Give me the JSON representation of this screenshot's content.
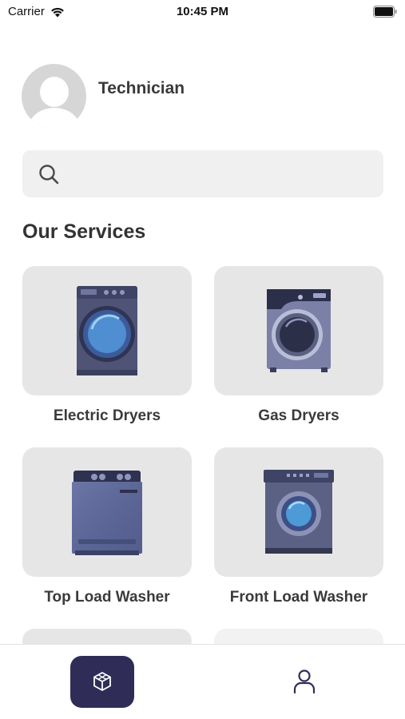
{
  "status_bar": {
    "carrier": "Carrier",
    "time": "10:45 PM"
  },
  "profile": {
    "name": "Technician",
    "avatar_icon": "person-placeholder-icon"
  },
  "search": {
    "placeholder": "",
    "icon": "search-icon"
  },
  "services": {
    "title": "Our Services",
    "items": [
      {
        "label": "Electric Dryers",
        "icon": "electric-dryer-icon"
      },
      {
        "label": "Gas Dryers",
        "icon": "gas-dryer-icon"
      },
      {
        "label": "Top Load Washer",
        "icon": "top-load-washer-icon"
      },
      {
        "label": "Front Load Washer",
        "icon": "front-load-washer-icon"
      }
    ]
  },
  "tab_bar": {
    "items": [
      {
        "icon": "cube-icon",
        "active": true
      },
      {
        "icon": "user-icon",
        "active": false
      }
    ],
    "active_color": "#2F2D57"
  }
}
